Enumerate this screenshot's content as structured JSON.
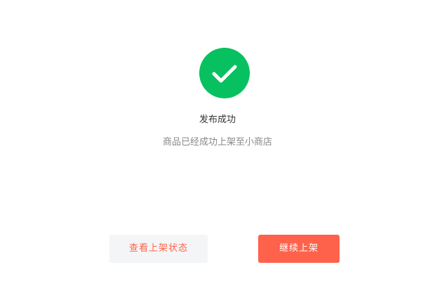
{
  "result": {
    "icon": "check-circle-icon",
    "icon_color": "#07c160",
    "title": "发布成功",
    "message": "商品已经成功上架至小商店"
  },
  "actions": {
    "view_status_label": "查看上架状态",
    "continue_label": "继续上架",
    "accent_color": "#ff624b"
  }
}
